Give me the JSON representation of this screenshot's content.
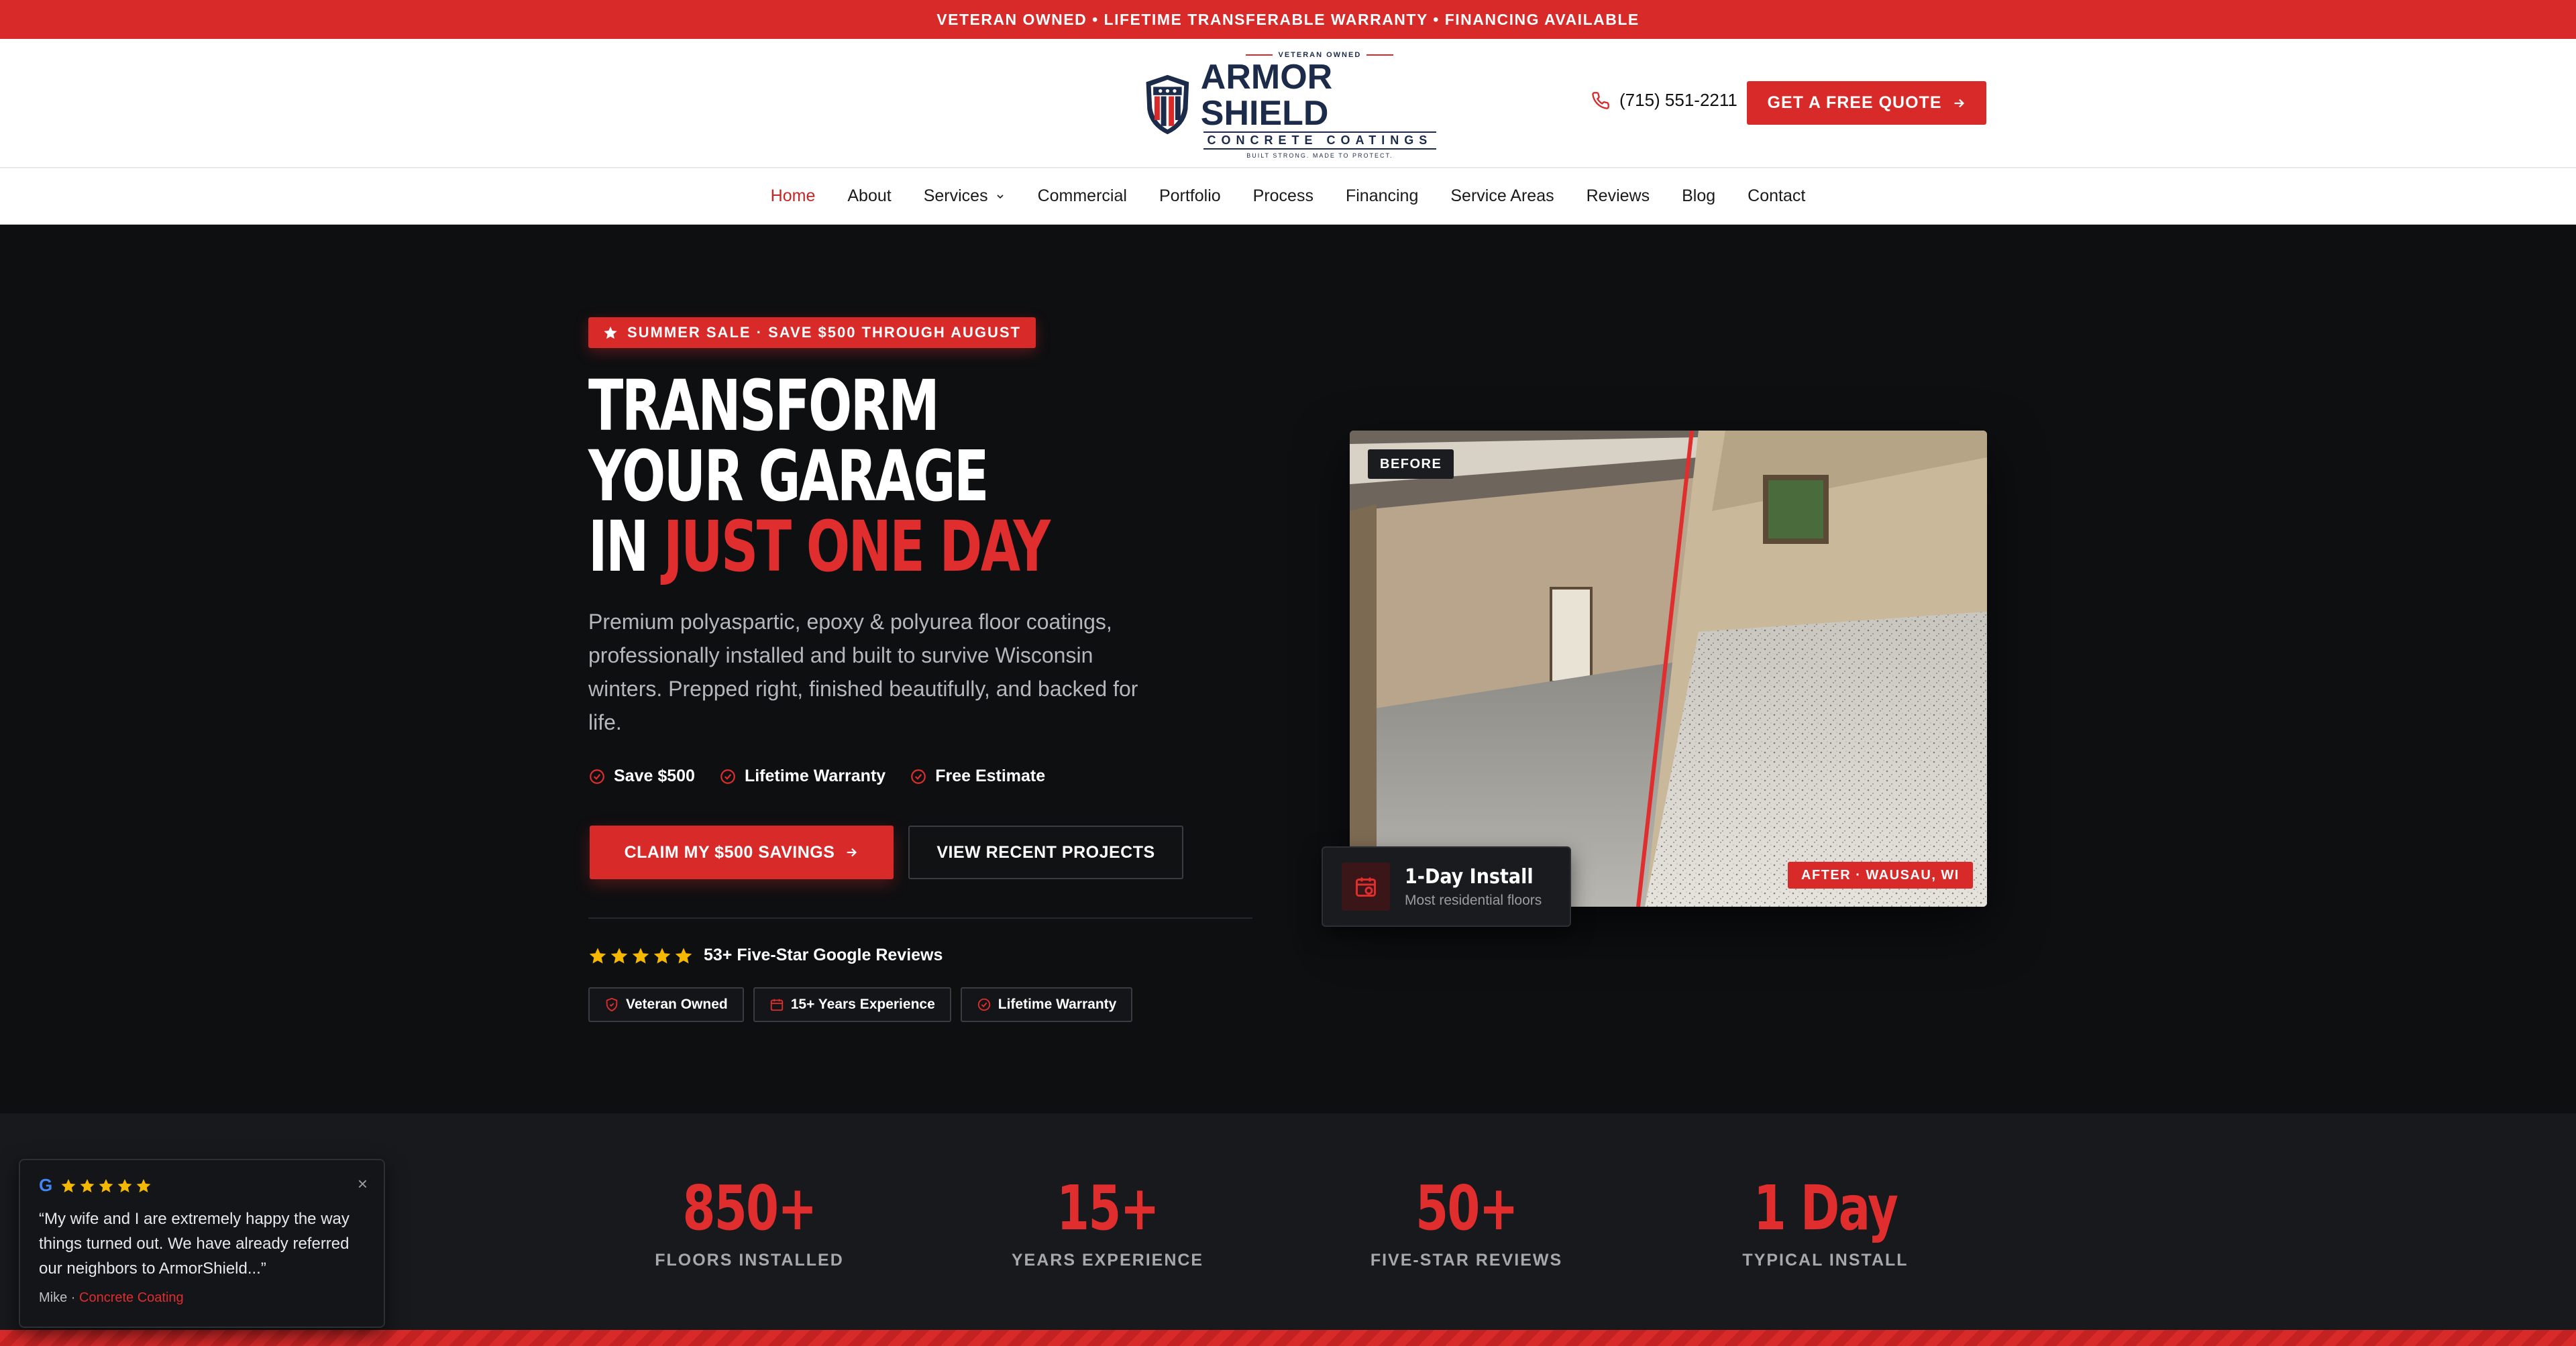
{
  "topbar": {
    "text": "VETERAN OWNED • LIFETIME TRANSFERABLE WARRANTY • FINANCING AVAILABLE"
  },
  "logo": {
    "veteran": "VETERAN OWNED",
    "name_1": "ARMOR",
    "name_2": "SHIELD",
    "sub": "CONCRETE COATINGS",
    "tagline": "BUILT STRONG. MADE TO PROTECT."
  },
  "header": {
    "phone": "(715) 551-2211",
    "quote_label": "GET A FREE QUOTE"
  },
  "nav": {
    "items": [
      {
        "label": "Home",
        "active": true
      },
      {
        "label": "About"
      },
      {
        "label": "Services"
      },
      {
        "label": "Commercial"
      },
      {
        "label": "Portfolio"
      },
      {
        "label": "Process"
      },
      {
        "label": "Financing"
      },
      {
        "label": "Service Areas"
      },
      {
        "label": "Reviews"
      },
      {
        "label": "Blog"
      },
      {
        "label": "Contact"
      }
    ]
  },
  "hero": {
    "badge": "SUMMER SALE · SAVE $500 THROUGH AUGUST",
    "headline_1": "TRANSFORM",
    "headline_2": "YOUR GARAGE",
    "headline_3a": "IN ",
    "headline_3b": "JUST ONE DAY",
    "lede": "Premium polyaspartic, epoxy & polyurea floor coatings, professionally installed and built to survive Wisconsin winters. Prepped right, finished beautifully, and backed for life.",
    "checks": [
      "Save $500",
      "Lifetime Warranty",
      "Free Estimate"
    ],
    "cta_primary": "CLAIM MY $500 SAVINGS",
    "cta_secondary": "VIEW RECENT PROJECTS",
    "reviews_text": "53+ Five-Star Google Reviews",
    "pills": [
      "Veteran Owned",
      "15+ Years Experience",
      "Lifetime Warranty"
    ],
    "image": {
      "before_label": "BEFORE",
      "after_label": "AFTER · WAUSAU, WI"
    },
    "install_card": {
      "title": "1-Day Install",
      "subtitle": "Most residential floors"
    }
  },
  "stats": [
    {
      "num": "850+",
      "label": "FLOORS INSTALLED"
    },
    {
      "num": "15+",
      "label": "YEARS EXPERIENCE"
    },
    {
      "num": "50+",
      "label": "FIVE-STAR REVIEWS"
    },
    {
      "num": "1 Day",
      "label": "TYPICAL INSTALL"
    }
  ],
  "review_popup": {
    "g": "G",
    "quote": "“My wife and I are extremely happy the way things turned out. We have already referred our neighbors to ArmorShield...”",
    "author": "Mike",
    "sep": " · ",
    "service": "Concrete Coating",
    "close": "×"
  },
  "colors": {
    "accent": "#d92a2a",
    "navy": "#1c2b4a",
    "dark_bg": "#0e0f11",
    "star": "#f5b800"
  },
  "icons": {
    "phone": "phone-icon",
    "arrow": "arrow-right-icon",
    "star": "star-icon",
    "check": "check-circle-icon",
    "shield": "shield-icon",
    "calendar": "calendar-icon",
    "chevron": "chevron-down-icon",
    "close": "close-icon"
  }
}
